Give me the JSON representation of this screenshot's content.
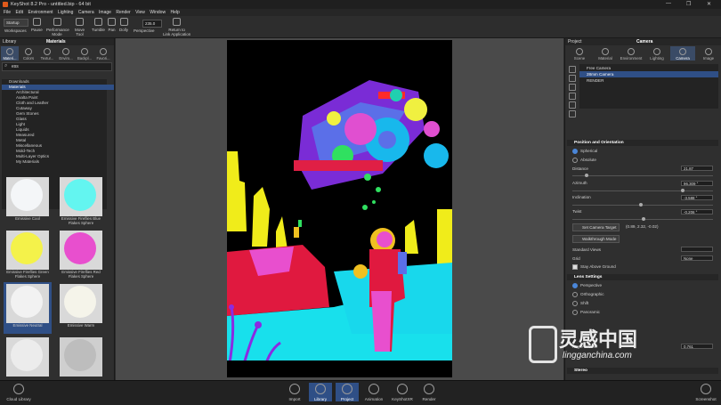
{
  "window": {
    "title": "KeyShot 8.2 Pro - untitled.bip - 64 bit",
    "controls": [
      "—",
      "❐",
      "✕"
    ]
  },
  "menu": [
    "File",
    "Edit",
    "Environment",
    "Lighting",
    "Camera",
    "Image",
    "Render",
    "View",
    "Window",
    "Help"
  ],
  "toolbar": {
    "workspace_value": "Startup",
    "workspaces": "Workspaces",
    "pause": "Pause",
    "performance": "Performance\nMode",
    "move_tool": "Move\nTool",
    "tumble": "Tumble",
    "pan": "Pan",
    "dolly": "Dolly",
    "numeric": "235.0",
    "perspective": "Perspective",
    "return_link": "Return to\nLink Application"
  },
  "library": {
    "panel_label": "Library",
    "title": "Materials",
    "tabs": [
      "Materi...",
      "Colors",
      "Textur...",
      "Enviro...",
      "Backpl...",
      "Favori..."
    ],
    "search_value": "ess",
    "tree": [
      "Downloads",
      "Materials",
      "Architectural",
      "Axalta Paint",
      "Cloth and Leather",
      "Cutaway",
      "Gem Stones",
      "Glass",
      "Light",
      "Liquids",
      "Measured",
      "Metal",
      "Miscellaneous",
      "Mold-Tech",
      "Multi-Layer Optics",
      "My Materials"
    ],
    "selected_tree_index": 1,
    "thumbnails": [
      {
        "label": "Emissive Cool",
        "color": "#f4f6f8"
      },
      {
        "label": "Emissive Fireflies Blue Flakes Sphere",
        "color": "#63f5f0"
      },
      {
        "label": "Emissive Fireflies Green Flakes Sphere",
        "color": "#f4f24a"
      },
      {
        "label": "Emissive Fireflies Red Flakes Sphere",
        "color": "#e84fce"
      },
      {
        "label": "Emissive Neutral",
        "color": "#f2f2f2"
      },
      {
        "label": "Emissive Warm",
        "color": "#f5f4ea"
      },
      {
        "label": "",
        "color": "#ececec"
      },
      {
        "label": "",
        "color": "#bdbdbd"
      }
    ]
  },
  "project": {
    "panel_label": "Project",
    "title": "Camera",
    "tabs": [
      "Scene",
      "Material",
      "Environment",
      "Lighting",
      "Camera",
      "Image"
    ],
    "cameras": [
      "Free Camera",
      "28mm Camera",
      "RENDER"
    ],
    "selected_camera": 1,
    "position_section": "Position and Orientation",
    "spherical": "Spherical",
    "absolute": "Absolute",
    "distance_label": "Distance",
    "distance_value": "21.87",
    "azimuth_label": "Azimuth",
    "azimuth_value": "96.309 °",
    "inclination_label": "Inclination",
    "inclination_value": "-3.588 °",
    "twist_label": "Twist",
    "twist_value": "-0.206 °",
    "set_target": "Set Camera Target",
    "target_coords": "(0.89, 2.32, -0.02)",
    "walkthrough": "Walkthrough Mode",
    "standard_views": "Standard Views",
    "grid_label": "Grid",
    "grid_value": "None",
    "stay_above": "Stay Above Ground",
    "lens_section": "Lens Settings",
    "lens_options": [
      "Perspective",
      "Orthographic",
      "Shift",
      "Panoramic"
    ],
    "angle_label": "Angle of View",
    "angle_value": "0.761",
    "stereo_section": "Stereo"
  },
  "bottom": {
    "cloud_library": "Cloud Library",
    "buttons": [
      "Import",
      "Library",
      "Project",
      "Animation",
      "KeyShotXR",
      "Render"
    ],
    "active_buttons": [
      1,
      2
    ],
    "screenshot": "Screenshot"
  },
  "watermark": {
    "chinese": "灵感中国",
    "url": "lingganchina.com"
  },
  "accent_color": "#2f4f86"
}
